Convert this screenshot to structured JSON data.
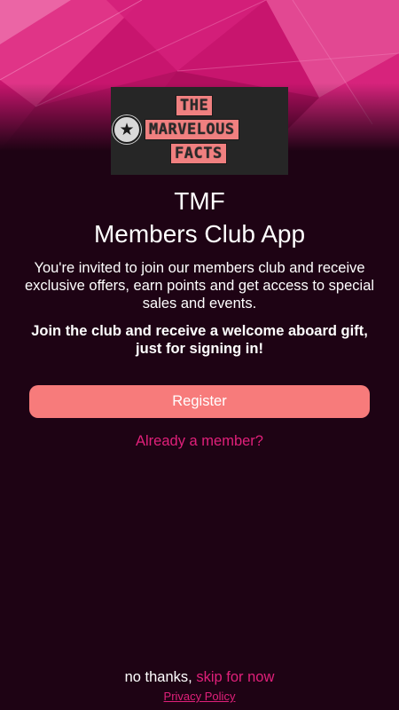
{
  "header": {
    "logo": {
      "line1": "THE",
      "line2": "MARVELOUS",
      "line3": "FACTS",
      "badge_icon": "star-badge-icon"
    }
  },
  "main": {
    "title_line1": "TMF",
    "title_line2": "Members Club App",
    "description": "You're invited to join our members club and receive exclusive offers, earn points and get access to special sales and events.",
    "promo": "Join the club and receive a welcome aboard gift, just for signing in!",
    "register_label": "Register",
    "member_link": "Already a member?"
  },
  "footer": {
    "skip_prefix": "no thanks,",
    "skip_link": "skip for now",
    "privacy": "Privacy Policy"
  },
  "colors": {
    "background": "#1e0314",
    "accent_pink": "#e0207a",
    "button": "#f77b7b",
    "hero_magenta": "#c8156e"
  }
}
